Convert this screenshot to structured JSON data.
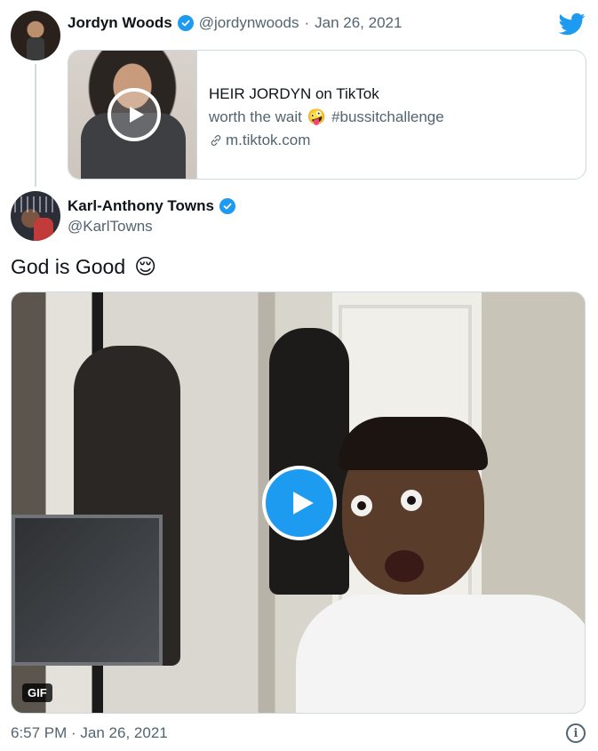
{
  "quoted_tweet": {
    "author_name": "Jordyn Woods",
    "author_handle": "@jordynwoods",
    "separator": "·",
    "date": "Jan 26, 2021",
    "card": {
      "title": "HEIR JORDYN on TikTok",
      "description": "worth the wait",
      "description_emoji": "🤪",
      "hashtag": "#bussitchallenge",
      "link": "m.tiktok.com"
    }
  },
  "main_tweet": {
    "author_name": "Karl-Anthony Towns",
    "author_handle": "@KarlTowns",
    "text": "God is Good",
    "text_emoji": "😌",
    "media_badge": "GIF",
    "timestamp": "6:57 PM · Jan 26, 2021"
  },
  "icons": {
    "brand": "twitter-bird-icon",
    "verified": "verified-badge-icon",
    "play": "play-icon",
    "link": "link-icon",
    "info": "info-icon"
  },
  "colors": {
    "accent": "#1d9bf0",
    "text_primary": "#0f1419",
    "text_secondary": "#536471",
    "border": "#cfd9de"
  }
}
